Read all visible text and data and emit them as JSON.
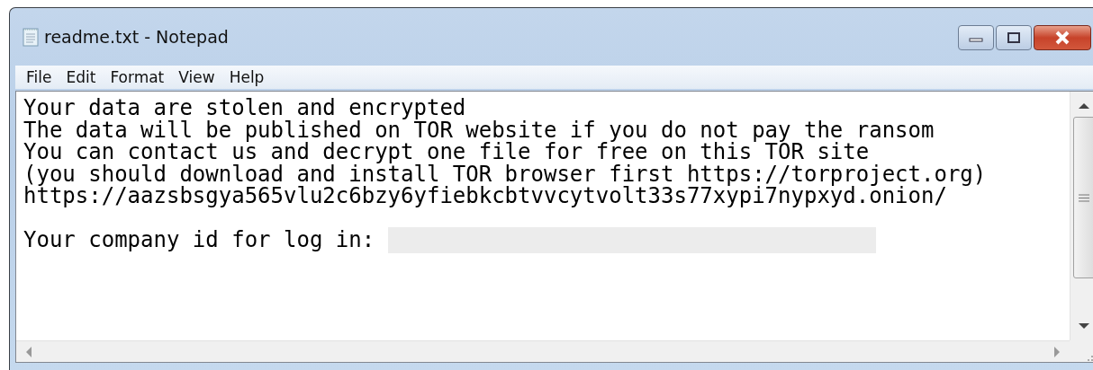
{
  "window": {
    "title": "readme.txt - Notepad"
  },
  "menu": [
    {
      "label": "File"
    },
    {
      "label": "Edit"
    },
    {
      "label": "Format"
    },
    {
      "label": "View"
    },
    {
      "label": "Help"
    }
  ],
  "document": {
    "lines": [
      "Your data are stolen and encrypted",
      "The data will be published on TOR website if you do not pay the ransom",
      "You can contact us and decrypt one file for free on this TOR site",
      "(you should download and install TOR browser first https://torproject.org)",
      "https://aazsbsgya565vlu2c6bzy6yfiebkcbtvvcytvolt33s77xypi7nypxyd.onion/"
    ],
    "login_line": "Your company id for log in: "
  }
}
